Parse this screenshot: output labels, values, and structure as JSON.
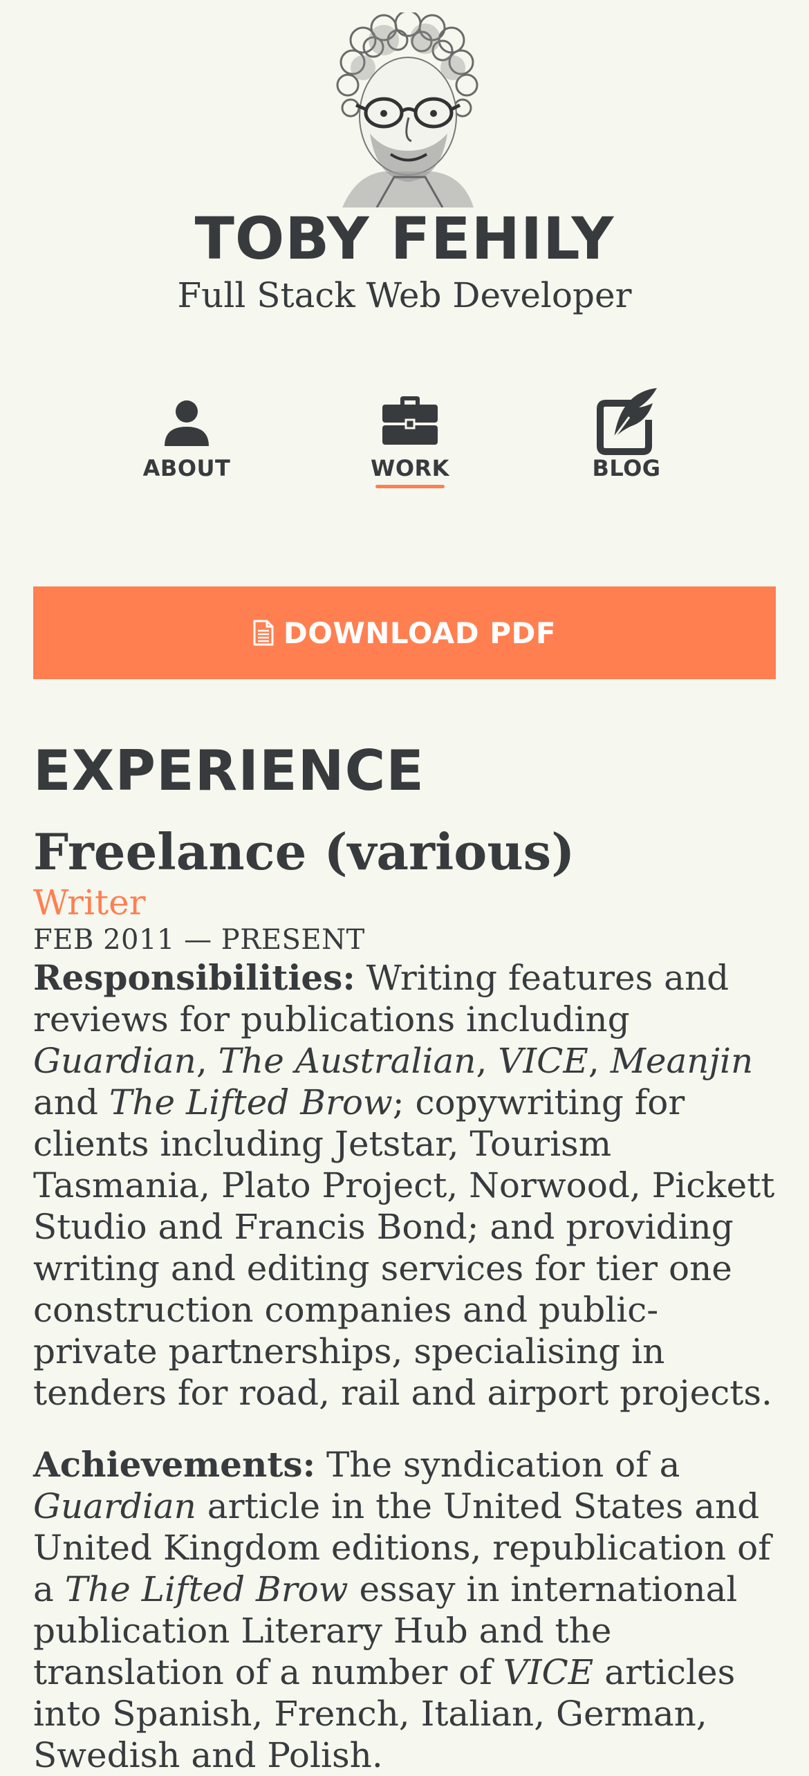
{
  "header": {
    "name": "TOBY FEHILY",
    "subtitle": "Full Stack Web Developer",
    "avatar_icon": "caricature-avatar"
  },
  "nav": {
    "items": [
      {
        "label": "ABOUT",
        "icon": "user-icon",
        "active": false
      },
      {
        "label": "WORK",
        "icon": "briefcase-icon",
        "active": true
      },
      {
        "label": "BLOG",
        "icon": "edit-quill-icon",
        "active": false
      }
    ]
  },
  "download": {
    "label": "DOWNLOAD PDF",
    "icon": "document-icon"
  },
  "colors": {
    "accent": "#ff7f50",
    "text": "#373b3e",
    "background": "#f6f7ee"
  },
  "experience": {
    "title": "EXPERIENCE",
    "jobs": [
      {
        "company": "Freelance (various)",
        "role": "Writer",
        "dates": "FEB 2011 — PRESENT",
        "responsibilities_label": "Responsibilities:",
        "responsibilities_parts": [
          " Writing features and reviews for publications including ",
          "Guardian",
          ", ",
          "The Australian",
          ", ",
          "VICE",
          ", ",
          "Meanjin",
          " and ",
          "The Lifted Brow",
          "; copywriting for clients including Jetstar, Tourism Tasmania, Plato Project, Norwood, Pickett Studio and Francis Bond; and providing writing and editing services for tier one construction companies and public-private partnerships, specialising in tenders for road, rail and airport projects."
        ],
        "achievements_label": "Achievements:",
        "achievements_parts": [
          " The syndication of a ",
          "Guardian",
          " article in the United States and United Kingdom editions, republication of a ",
          "The Lifted Brow",
          " essay in international publication Literary Hub and the translation of a number of ",
          "VICE",
          " articles into Spanish, French, Italian, German, Swedish and Polish."
        ]
      }
    ]
  }
}
